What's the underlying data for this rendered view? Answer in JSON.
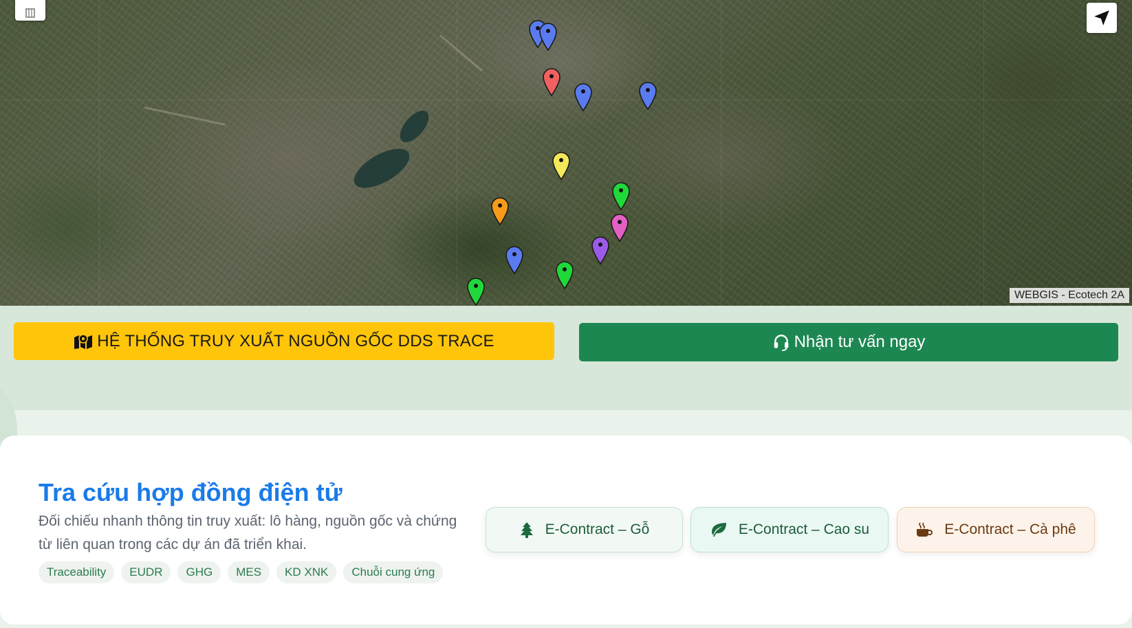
{
  "map": {
    "attribution": "WEBGIS - Ecotech 2A",
    "controls": {
      "layers_icon": "layers-icon",
      "locate_icon": "navigation-arrow-icon"
    },
    "markers": [
      {
        "color": "#5a7bf0",
        "name": "marker-blue"
      },
      {
        "color": "#5a7bf0",
        "name": "marker-blue"
      },
      {
        "color": "#f06060",
        "name": "marker-red"
      },
      {
        "color": "#5a7bf0",
        "name": "marker-blue"
      },
      {
        "color": "#5a7bf0",
        "name": "marker-blue"
      },
      {
        "color": "#f3e85a",
        "name": "marker-yellow"
      },
      {
        "color": "#21d83a",
        "name": "marker-green"
      },
      {
        "color": "#f59a1a",
        "name": "marker-orange"
      },
      {
        "color": "#e35fc2",
        "name": "marker-pink"
      },
      {
        "color": "#9b5ae8",
        "name": "marker-purple"
      },
      {
        "color": "#5a7bf0",
        "name": "marker-blue"
      },
      {
        "color": "#21d83a",
        "name": "marker-green"
      },
      {
        "color": "#21d83a",
        "name": "marker-green"
      }
    ]
  },
  "actions": {
    "trace_label": "HỆ THỐNG TRUY XUẤT NGUỒN GỐC DDS TRACE",
    "trace_icon": "map-pin-icon",
    "consult_label": "Nhận tư vấn ngay",
    "consult_icon": "headset-icon"
  },
  "econtract": {
    "title": "Tra cứu hợp đồng điện tử",
    "description": "Đối chiếu nhanh thông tin truy xuất: lô hàng, nguồn gốc và chứng từ liên quan trong các dự án đã triển khai.",
    "tags": [
      "Traceability",
      "EUDR",
      "GHG",
      "MES",
      "KD XNK",
      "Chuỗi cung ứng"
    ],
    "buttons": [
      {
        "label": "E-Contract – Gỗ",
        "icon": "tree-icon"
      },
      {
        "label": "E-Contract – Cao su",
        "icon": "leaf-icon"
      },
      {
        "label": "E-Contract – Cà phê",
        "icon": "coffee-cup-icon"
      }
    ]
  },
  "colors": {
    "trace_button": "#ffc50a",
    "consult_button": "#1d8752",
    "title": "#1a7be8"
  }
}
